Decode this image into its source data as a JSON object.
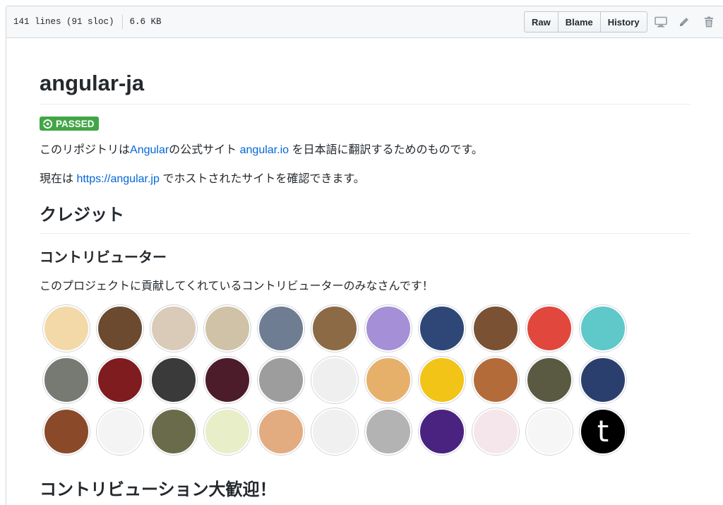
{
  "file_header": {
    "lines": "141 lines (91 sloc)",
    "size": "6.6 KB",
    "buttons": {
      "raw": "Raw",
      "blame": "Blame",
      "history": "History"
    },
    "icons": [
      "desktop-icon",
      "pencil-icon",
      "trash-icon"
    ]
  },
  "readme": {
    "title": "angular-ja",
    "badge": "PASSED",
    "intro": {
      "before": "このリポジトリは",
      "link1": "Angular",
      "middle": "の公式サイト ",
      "link2": "angular.io",
      "after": " を日本語に翻訳するためのものです。"
    },
    "host": {
      "before": "現在は ",
      "link": "https://angular.jp",
      "after": " でホストされたサイトを確認できます。"
    },
    "credit_heading": "クレジット",
    "contributors_heading": "コントリビューター",
    "contributors_text": "このプロジェクトに貢献してくれているコントリビューターのみなさんです！",
    "next_heading": "コントリビューション大歓迎！"
  },
  "avatars": [
    {
      "color": "#f3d9a8",
      "letter": ""
    },
    {
      "color": "#6b4a2f",
      "letter": ""
    },
    {
      "color": "#d9cbb8",
      "letter": ""
    },
    {
      "color": "#cfc2a6",
      "letter": ""
    },
    {
      "color": "#6f7d92",
      "letter": ""
    },
    {
      "color": "#8b6a45",
      "letter": ""
    },
    {
      "color": "#a58fd6",
      "letter": ""
    },
    {
      "color": "#2f4777",
      "letter": ""
    },
    {
      "color": "#7a5233",
      "letter": ""
    },
    {
      "color": "#e2473e",
      "letter": ""
    },
    {
      "color": "#5fc8c9",
      "letter": ""
    },
    {
      "color": "#767a72",
      "letter": ""
    },
    {
      "color": "#7e1c20",
      "letter": ""
    },
    {
      "color": "#3a3a3a",
      "letter": ""
    },
    {
      "color": "#4d1c2b",
      "letter": ""
    },
    {
      "color": "#9d9d9d",
      "letter": ""
    },
    {
      "color": "#efefef",
      "letter": ""
    },
    {
      "color": "#e7b06a",
      "letter": ""
    },
    {
      "color": "#f2c418",
      "letter": ""
    },
    {
      "color": "#b46b3a",
      "letter": ""
    },
    {
      "color": "#5a5a43",
      "letter": ""
    },
    {
      "color": "#2b3f6e",
      "letter": ""
    },
    {
      "color": "#8a4a2a",
      "letter": ""
    },
    {
      "color": "#f4f4f4",
      "letter": ""
    },
    {
      "color": "#6a6b4a",
      "letter": ""
    },
    {
      "color": "#e8eec8",
      "letter": ""
    },
    {
      "color": "#e2ac80",
      "letter": ""
    },
    {
      "color": "#f0f0f0",
      "letter": ""
    },
    {
      "color": "#b3b3b3",
      "letter": ""
    },
    {
      "color": "#4a2380",
      "letter": ""
    },
    {
      "color": "#f4e6ea",
      "letter": ""
    },
    {
      "color": "#f6f6f6",
      "letter": ""
    },
    {
      "color": "#000000",
      "letter": "t"
    }
  ]
}
